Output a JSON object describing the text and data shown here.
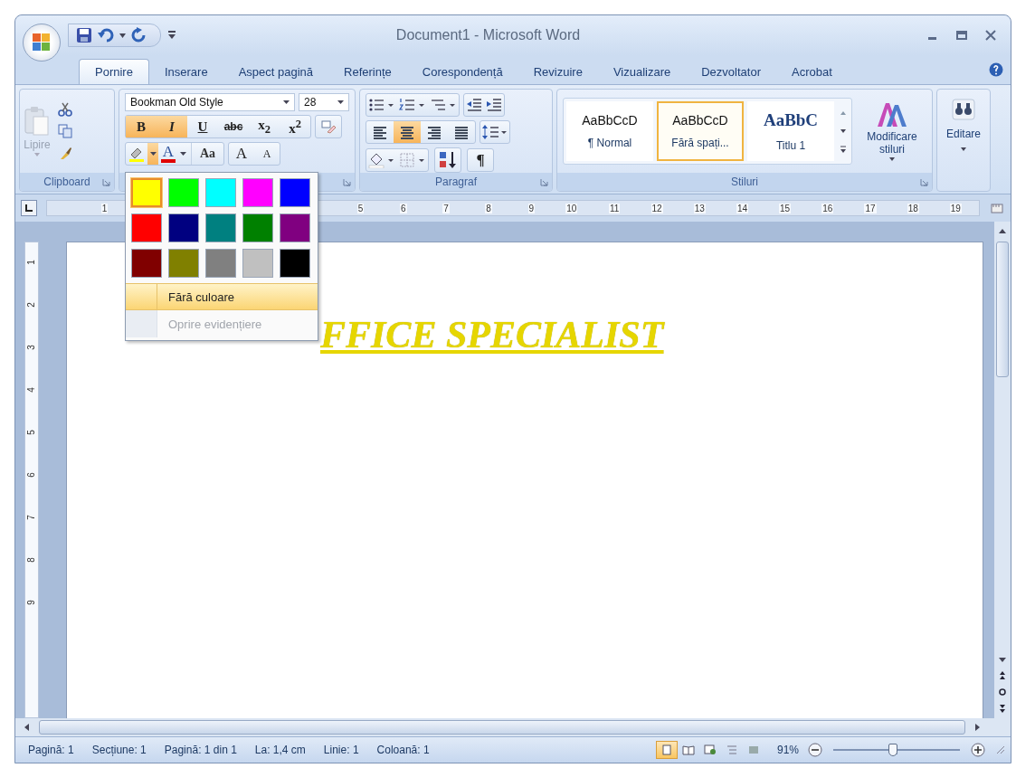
{
  "window": {
    "title": "Document1 - Microsoft Word"
  },
  "tabs": [
    {
      "label": "Pornire",
      "selected": true
    },
    {
      "label": "Inserare",
      "selected": false
    },
    {
      "label": "Aspect pagină",
      "selected": false
    },
    {
      "label": "Referințe",
      "selected": false
    },
    {
      "label": "Corespondență",
      "selected": false
    },
    {
      "label": "Revizuire",
      "selected": false
    },
    {
      "label": "Vizualizare",
      "selected": false
    },
    {
      "label": "Dezvoltator",
      "selected": false
    },
    {
      "label": "Acrobat",
      "selected": false
    }
  ],
  "ribbon": {
    "clipboard": {
      "paste_label": "Lipire",
      "group_label": "Clipboard"
    },
    "font": {
      "font_name": "Bookman Old Style",
      "font_size": "28",
      "format_buttons": [
        {
          "label": "B",
          "selected": true
        },
        {
          "label": "I",
          "selected": true
        },
        {
          "label": "U",
          "selected": false
        },
        {
          "label": "abc",
          "selected": false
        },
        {
          "label": "x$_{2}$",
          "selected": false
        },
        {
          "label": "x$^{2}$",
          "selected": false
        }
      ],
      "highlight_menu_open": true,
      "font_color_label": "A",
      "case_label": "Aa",
      "grow_label": "A",
      "shrink_label": "A"
    },
    "paragraph": {
      "align_buttons": [
        {
          "kind": "left",
          "selected": false
        },
        {
          "kind": "center",
          "selected": true
        },
        {
          "kind": "right",
          "selected": false
        },
        {
          "kind": "justify",
          "selected": false
        }
      ],
      "pilcrow": "¶",
      "group_label": "Paragraf"
    },
    "styles": {
      "items": [
        {
          "preview": "AaBbCcD",
          "name": "¶ Normal",
          "kind": "sans",
          "selected": false
        },
        {
          "preview": "AaBbCcD",
          "name": "Fără spați...",
          "kind": "sans",
          "selected": true
        },
        {
          "preview": "AaBbC",
          "name": "Titlu 1",
          "kind": "serif",
          "selected": false
        }
      ],
      "change_styles_label": "Modificare stiluri",
      "group_label": "Stiluri"
    },
    "editing": {
      "label": "Editare"
    }
  },
  "highlight_menu": {
    "colors": [
      {
        "color": "#ffff00",
        "selected": true
      },
      {
        "color": "#00ff00",
        "selected": false
      },
      {
        "color": "#00ffff",
        "selected": false
      },
      {
        "color": "#ff00ff",
        "selected": false
      },
      {
        "color": "#0000ff",
        "selected": false
      },
      {
        "color": "#ff0000",
        "selected": false
      },
      {
        "color": "#000080",
        "selected": false
      },
      {
        "color": "#008080",
        "selected": false
      },
      {
        "color": "#008000",
        "selected": false
      },
      {
        "color": "#800080",
        "selected": false
      },
      {
        "color": "#800000",
        "selected": false
      },
      {
        "color": "#808000",
        "selected": false
      },
      {
        "color": "#808080",
        "selected": false
      },
      {
        "color": "#c0c0c0",
        "selected": false
      },
      {
        "color": "#000000",
        "selected": false
      }
    ],
    "items": [
      {
        "label": "Fără culoare",
        "highlighted": true,
        "disabled": false
      },
      {
        "label": "Oprire evidențiere",
        "highlighted": false,
        "disabled": true
      }
    ]
  },
  "ruler": {
    "left_labels": [
      "1"
    ],
    "right_labels": [
      "5",
      "6",
      "7",
      "8",
      "9",
      "10",
      "11",
      "12",
      "13",
      "14",
      "15",
      "16",
      "17",
      "18",
      "19"
    ]
  },
  "vertical_ruler": {
    "labels": [
      "1",
      "2",
      "3",
      "4",
      "5",
      "6",
      "7",
      "8",
      "9"
    ]
  },
  "document": {
    "text": "FFICE SPECIALIST"
  },
  "status_bar": {
    "items": [
      "Pagină: 1",
      "Secțiune: 1",
      "Pagină: 1 din 1",
      "La: 1,4 cm",
      "Linie: 1",
      "Coloană: 1"
    ],
    "views": [
      {
        "kind": "print",
        "selected": true
      },
      {
        "kind": "reading",
        "selected": false
      },
      {
        "kind": "web",
        "selected": false
      },
      {
        "kind": "outline",
        "selected": false
      },
      {
        "kind": "draft",
        "selected": false
      }
    ],
    "zoom": "91%",
    "zoom_slider": {
      "level": 0.47
    }
  }
}
